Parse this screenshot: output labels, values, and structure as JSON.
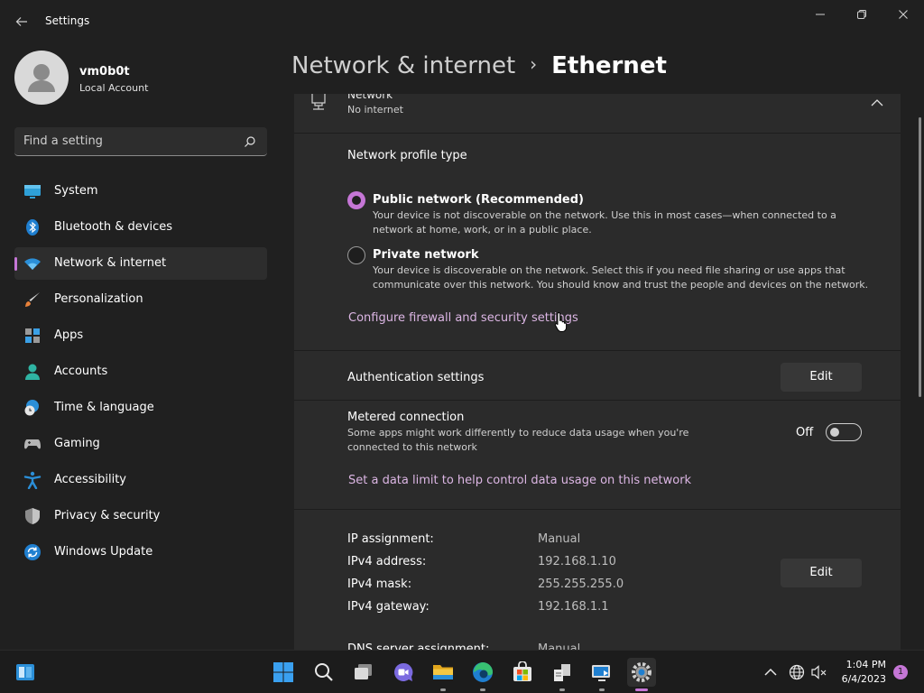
{
  "window": {
    "title": "Settings",
    "back_icon": "back-arrow-icon",
    "controls": [
      "minimize-icon",
      "restore-icon",
      "close-icon"
    ]
  },
  "profile": {
    "name": "vm0b0t",
    "account_type": "Local Account"
  },
  "search": {
    "placeholder": "Find a setting"
  },
  "sidebar": {
    "items": [
      {
        "label": "System",
        "icon": "system-icon"
      },
      {
        "label": "Bluetooth & devices",
        "icon": "bluetooth-icon"
      },
      {
        "label": "Network & internet",
        "icon": "wifi-icon",
        "active": true
      },
      {
        "label": "Personalization",
        "icon": "brush-icon"
      },
      {
        "label": "Apps",
        "icon": "apps-icon"
      },
      {
        "label": "Accounts",
        "icon": "account-icon"
      },
      {
        "label": "Time & language",
        "icon": "clock-globe-icon"
      },
      {
        "label": "Gaming",
        "icon": "gamepad-icon"
      },
      {
        "label": "Accessibility",
        "icon": "accessibility-icon"
      },
      {
        "label": "Privacy & security",
        "icon": "shield-icon"
      },
      {
        "label": "Windows Update",
        "icon": "update-icon"
      }
    ]
  },
  "header": {
    "parent": "Network & internet",
    "separator": "›",
    "current": "Ethernet"
  },
  "network": {
    "name": "Network",
    "status": "No internet"
  },
  "profile_type": {
    "heading": "Network profile type",
    "options": [
      {
        "title": "Public network (Recommended)",
        "description": "Your device is not discoverable on the network. Use this in most cases—when connected to a network at home, work, or in a public place.",
        "selected": true
      },
      {
        "title": "Private network",
        "description": "Your device is discoverable on the network. Select this if you need file sharing or use apps that communicate over this network. You should know and trust the people and devices on the network.",
        "selected": false
      }
    ],
    "firewall_link": "Configure firewall and security settings"
  },
  "authentication": {
    "label": "Authentication settings",
    "button": "Edit"
  },
  "metered": {
    "title": "Metered connection",
    "description": "Some apps might work differently to reduce data usage when you're connected to this network",
    "state_label": "Off",
    "enabled": false,
    "data_limit_link": "Set a data limit to help control data usage on this network"
  },
  "ip_settings": {
    "rows": [
      {
        "label": "IP assignment:",
        "value": "Manual"
      },
      {
        "label": "IPv4 address:",
        "value": "192.168.1.10"
      },
      {
        "label": "IPv4 mask:",
        "value": "255.255.255.0"
      },
      {
        "label": "IPv4 gateway:",
        "value": "192.168.1.1"
      }
    ],
    "partial_row": {
      "label": "DNS server assignment:",
      "value": "Manual"
    },
    "edit_button": "Edit"
  },
  "taskbar": {
    "apps": [
      "start-icon",
      "search-icon",
      "task-view-icon",
      "chat-icon",
      "file-explorer-icon",
      "edge-icon",
      "store-icon",
      "network-app-icon",
      "remote-desktop-icon",
      "settings-icon"
    ],
    "active_app": "settings-icon",
    "tray": [
      "chevron-up-icon",
      "globe-icon",
      "speaker-muted-icon"
    ],
    "time": "1:04 PM",
    "date": "6/4/2023",
    "notification_count": "1"
  },
  "colors": {
    "accent": "#c576d6",
    "background": "#202020",
    "card": "#2b2b2b",
    "link": "#dcb6e4"
  }
}
